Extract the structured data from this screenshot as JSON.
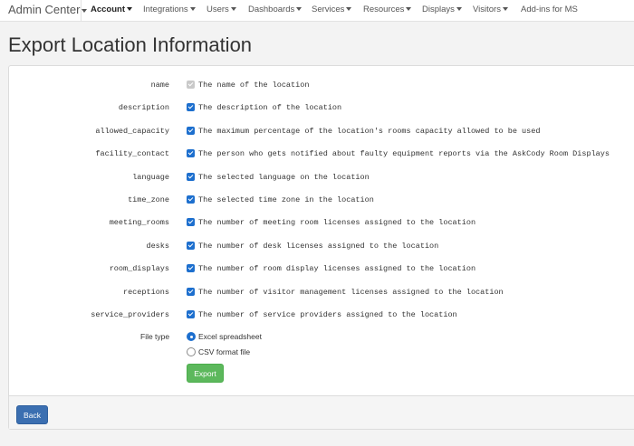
{
  "navbar": {
    "brand": "Admin Center",
    "items": [
      {
        "label": "Account",
        "dropdown": true,
        "active": true
      },
      {
        "label": "Integrations",
        "dropdown": true
      },
      {
        "label": "Users",
        "dropdown": true
      },
      {
        "label": "Dashboards",
        "dropdown": true
      },
      {
        "label": "Services",
        "dropdown": true
      },
      {
        "label": "Resources",
        "dropdown": true
      },
      {
        "label": "Displays",
        "dropdown": true
      },
      {
        "label": "Visitors",
        "dropdown": true
      },
      {
        "label": "Add-ins for MS",
        "dropdown": false
      }
    ]
  },
  "page": {
    "title": "Export Location Information"
  },
  "fields": [
    {
      "name": "name",
      "description": "The name of the location",
      "checked": true,
      "disabled": true
    },
    {
      "name": "description",
      "description": "The description of the location",
      "checked": true
    },
    {
      "name": "allowed_capacity",
      "description": "The maximum percentage of the location's rooms capacity allowed to be used",
      "checked": true
    },
    {
      "name": "facility_contact",
      "description": "The person who gets notified about faulty equipment reports via the AskCody Room Displays",
      "checked": true
    },
    {
      "name": "language",
      "description": "The selected language on the location",
      "checked": true
    },
    {
      "name": "time_zone",
      "description": "The selected time zone in the location",
      "checked": true
    },
    {
      "name": "meeting_rooms",
      "description": "The number of meeting room licenses assigned to the location",
      "checked": true
    },
    {
      "name": "desks",
      "description": "The number of desk licenses assigned to the location",
      "checked": true
    },
    {
      "name": "room_displays",
      "description": "The number of room display licenses assigned to the location",
      "checked": true
    },
    {
      "name": "receptions",
      "description": "The number of visitor management licenses assigned to the location",
      "checked": true
    },
    {
      "name": "service_providers",
      "description": "The number of service providers assigned to the location",
      "checked": true
    }
  ],
  "file_type": {
    "label": "File type",
    "options": [
      {
        "label": "Excel spreadsheet",
        "selected": true
      },
      {
        "label": "CSV format file",
        "selected": false
      }
    ]
  },
  "buttons": {
    "export": "Export",
    "back": "Back"
  },
  "colors": {
    "export": "#5cb85c",
    "back": "#3b6fb1",
    "checkbox": "#1d6fce"
  }
}
